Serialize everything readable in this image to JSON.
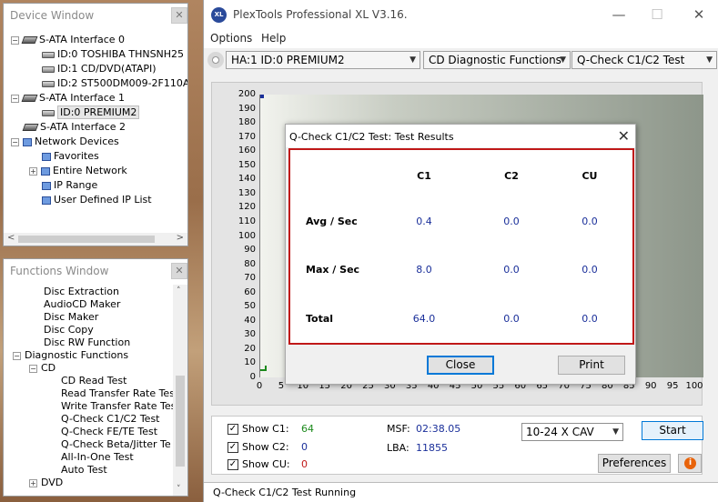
{
  "device_window": {
    "title": "Device Window",
    "close_label": "✕",
    "items": [
      {
        "label": "S-ATA Interface 0"
      },
      {
        "label": "ID:0  TOSHIBA THNSNH25"
      },
      {
        "label": "ID:1  CD/DVD(ATAPI)"
      },
      {
        "label": "ID:2  ST500DM009-2F110A"
      },
      {
        "label": "S-ATA Interface 1"
      },
      {
        "label": "ID:0  PREMIUM2"
      },
      {
        "label": "S-ATA Interface 2"
      },
      {
        "label": "Network Devices"
      },
      {
        "label": "Favorites"
      },
      {
        "label": "Entire Network"
      },
      {
        "label": "IP Range"
      },
      {
        "label": "User Defined IP List"
      }
    ]
  },
  "functions_window": {
    "title": "Functions Window",
    "close_label": "✕",
    "items": [
      {
        "label": "Disc Extraction"
      },
      {
        "label": "AudioCD Maker"
      },
      {
        "label": "Disc Maker"
      },
      {
        "label": "Disc Copy"
      },
      {
        "label": "Disc RW Function"
      },
      {
        "label": "Diagnostic Functions"
      },
      {
        "label": "CD"
      },
      {
        "label": "CD Read Test"
      },
      {
        "label": "Read Transfer Rate Tes"
      },
      {
        "label": "Write Transfer Rate Tes"
      },
      {
        "label": "Q-Check C1/C2 Test"
      },
      {
        "label": "Q-Check FE/TE Test"
      },
      {
        "label": "Q-Check Beta/Jitter Te"
      },
      {
        "label": "All-In-One Test"
      },
      {
        "label": "Auto Test"
      },
      {
        "label": "DVD"
      }
    ]
  },
  "app": {
    "title": "PlexTools Professional XL V3.16.",
    "icon_text": "XL",
    "menu": [
      "Options",
      "Help"
    ]
  },
  "toolbar": {
    "device": "HA:1 ID:0  PREMIUM2",
    "category": "CD Diagnostic Functions",
    "test": "Q-Check C1/C2 Test"
  },
  "graph": {
    "y_ticks": [
      "200",
      "190",
      "180",
      "170",
      "160",
      "150",
      "140",
      "130",
      "120",
      "110",
      "100",
      "90",
      "80",
      "70",
      "60",
      "50",
      "40",
      "30",
      "20",
      "10",
      "0"
    ],
    "x_ticks": [
      "0",
      "5",
      "10",
      "15",
      "20",
      "25",
      "30",
      "35",
      "40",
      "45",
      "50",
      "55",
      "60",
      "65",
      "70",
      "75",
      "80",
      "85",
      "90",
      "95",
      "100"
    ],
    "xlim": [
      0,
      100
    ],
    "ylim": [
      0,
      200
    ]
  },
  "controls": {
    "show_c1_label": "Show C1:",
    "show_c1_value": "64",
    "show_c2_label": "Show C2:",
    "show_c2_value": "0",
    "show_cu_label": "Show CU:",
    "show_cu_value": "0",
    "check_mark": "✓",
    "msf_label": "MSF:",
    "msf_value": "02:38.05",
    "lba_label": "LBA:",
    "lba_value": "11855",
    "speed": "10-24 X CAV",
    "start_label": "Start",
    "preferences_label": "Preferences",
    "info_icon_text": "i",
    "colors": {
      "c1": "#1c8a1c",
      "c2": "#1a2f9a",
      "cu": "#c01818"
    }
  },
  "status": {
    "text": "Q-Check C1/C2 Test Running"
  },
  "dialog": {
    "title": "Q-Check C1/C2 Test: Test Results",
    "close_symbol": "✕",
    "columns": [
      "C1",
      "C2",
      "CU"
    ],
    "rows": [
      {
        "label": "Avg / Sec",
        "values": [
          "0.4",
          "0.0",
          "0.0"
        ]
      },
      {
        "label": "Max / Sec",
        "values": [
          "8.0",
          "0.0",
          "0.0"
        ]
      },
      {
        "label": "Total",
        "values": [
          "64.0",
          "0.0",
          "0.0"
        ]
      }
    ],
    "close_label": "Close",
    "print_label": "Print"
  }
}
